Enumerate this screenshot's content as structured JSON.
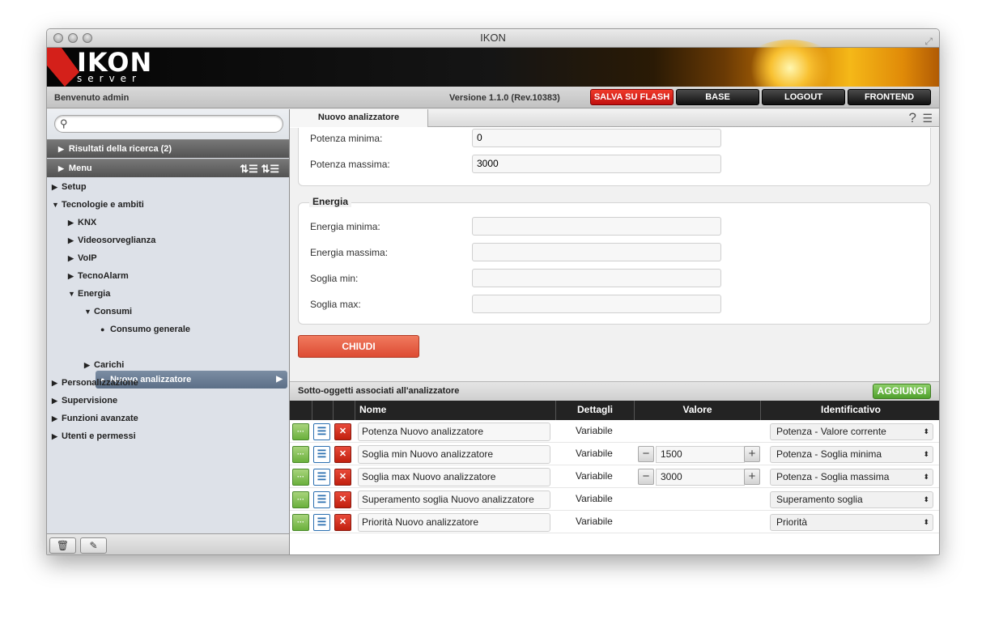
{
  "window": {
    "title": "IKON"
  },
  "logo": {
    "main": "IKON",
    "sub": "server"
  },
  "header": {
    "welcome": "Benvenuto admin",
    "version": "Versione 1.1.0 (Rev.10383)",
    "buttons": {
      "flash": "SALVA SU FLASH",
      "base": "BASE",
      "logout": "LOGOUT",
      "frontend": "FRONTEND"
    }
  },
  "sidebar": {
    "search_value": "",
    "search_results": "Risultati della ricerca (2)",
    "menu": "Menu",
    "tree": [
      "Setup",
      "Tecnologie e ambiti",
      "KNX",
      "Videosorveglianza",
      "VoIP",
      "TecnoAlarm",
      "Energia",
      "Consumi",
      "Consumo generale",
      "Nuovo analizzatore",
      "Carichi",
      "Personalizzazione",
      "Supervisione",
      "Funzioni avanzate",
      "Utenti e permessi"
    ]
  },
  "tab": {
    "label": "Nuovo analizzatore"
  },
  "form": {
    "potenza_min_label": "Potenza minima:",
    "potenza_min_value": "0",
    "potenza_max_label": "Potenza massima:",
    "potenza_max_value": "3000",
    "energia_legend": "Energia",
    "energia_min_label": "Energia minima:",
    "energia_max_label": "Energia massima:",
    "soglia_min_label": "Soglia min:",
    "soglia_max_label": "Soglia max:",
    "close": "CHIUDI"
  },
  "subobjects": {
    "title": "Sotto-oggetti associati all'analizzatore",
    "add": "AGGIUNGI",
    "columns": {
      "name": "Nome",
      "details": "Dettagli",
      "value": "Valore",
      "ident": "Identificativo"
    },
    "rows": [
      {
        "name": "Potenza Nuovo analizzatore",
        "details": "Variabile",
        "value": "",
        "ident": "Potenza - Valore corrente"
      },
      {
        "name": "Soglia min Nuovo analizzatore",
        "details": "Variabile",
        "value": "1500",
        "ident": "Potenza - Soglia minima"
      },
      {
        "name": "Soglia max Nuovo analizzatore",
        "details": "Variabile",
        "value": "3000",
        "ident": "Potenza - Soglia massima"
      },
      {
        "name": "Superamento soglia Nuovo analizzatore",
        "details": "Variabile",
        "value": "",
        "ident": "Superamento soglia"
      },
      {
        "name": "Priorità Nuovo analizzatore",
        "details": "Variabile",
        "value": "",
        "ident": "Priorità"
      }
    ]
  },
  "colors": {
    "accent_red": "#d4201a",
    "green": "#5cae34",
    "selected": "#6b7e95"
  }
}
